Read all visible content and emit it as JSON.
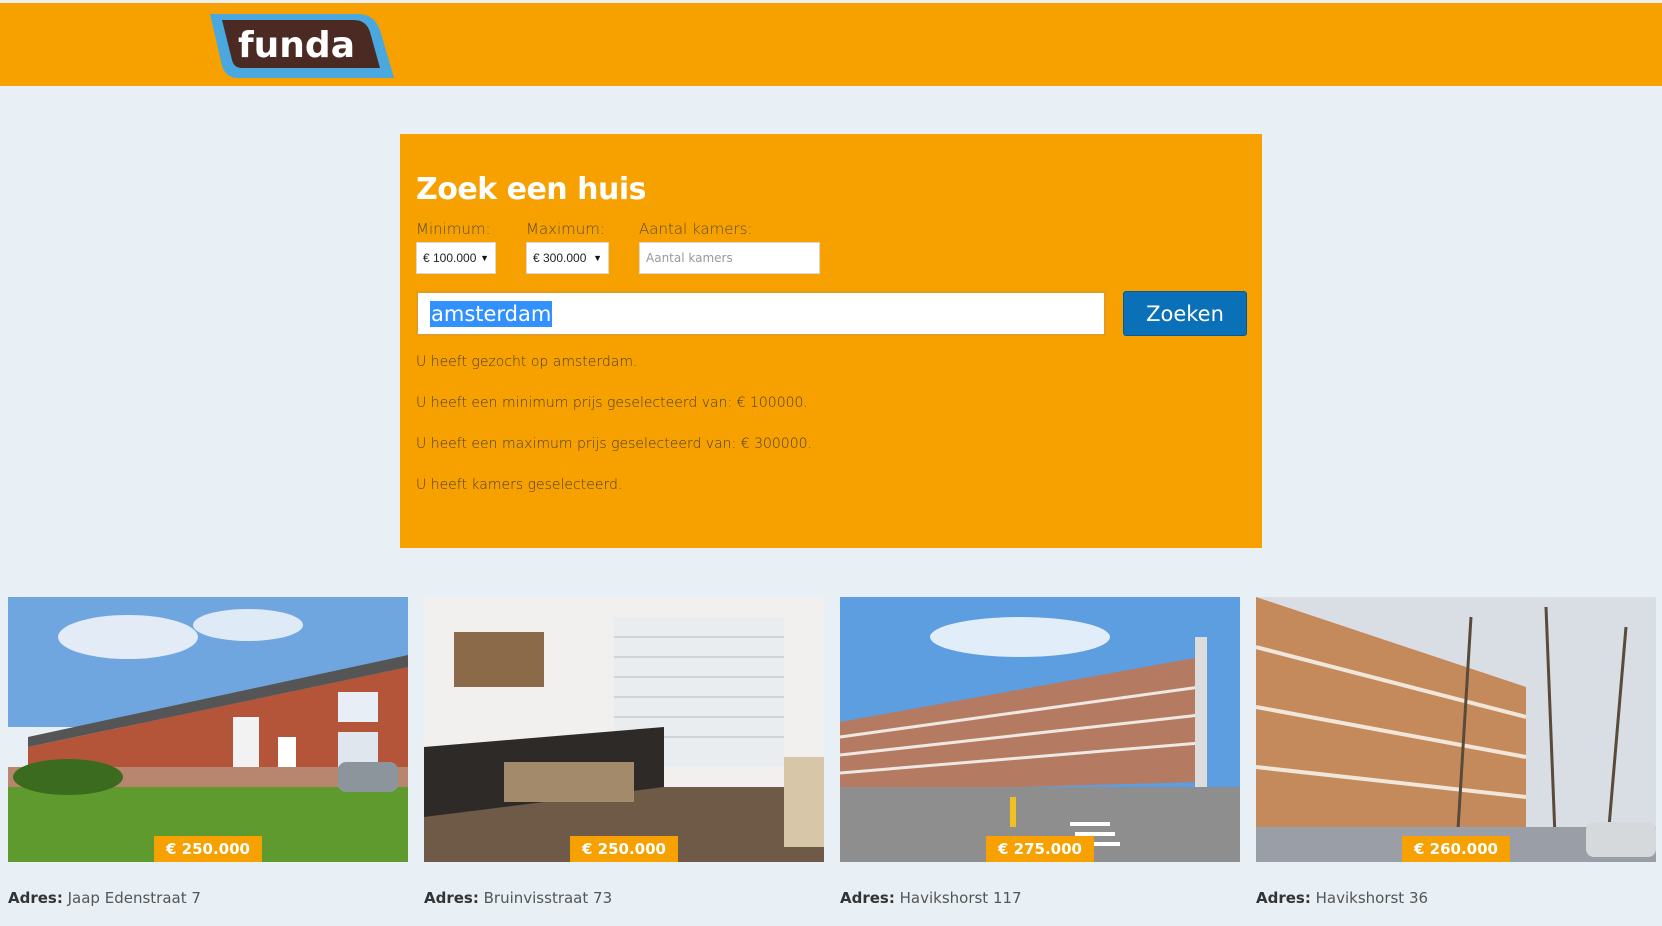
{
  "header": {
    "logo_text": "funda",
    "colors": {
      "bar": "#f7a100",
      "logo_fill": "#4a2a22",
      "logo_outline": "#4aa8e0"
    }
  },
  "search": {
    "title": "Zoek een huis",
    "min_label": "Minimum:",
    "min_value": "€ 100.000",
    "max_label": "Maximum:",
    "max_value": "€ 300.000",
    "rooms_label": "Aantal kamers:",
    "rooms_placeholder": "Aantal kamers",
    "query_value": "amsterdam",
    "button_label": "Zoeken"
  },
  "summary": [
    "U heeft gezocht op amsterdam.",
    "U heeft een minimum prijs geselecteerd van: € 100000.",
    "U heeft een maximum prijs geselecteerd van: € 300000.",
    "U heeft kamers geselecteerd."
  ],
  "listings": [
    {
      "price": "€ 250.000",
      "address_label": "Adres:",
      "address": "Jaap Edenstraat 7"
    },
    {
      "price": "€ 250.000",
      "address_label": "Adres:",
      "address": "Bruinvisstraat 73"
    },
    {
      "price": "€ 275.000",
      "address_label": "Adres:",
      "address": "Havikshorst 117"
    },
    {
      "price": "€ 260.000",
      "address_label": "Adres:",
      "address": "Havikshorst 36"
    }
  ]
}
